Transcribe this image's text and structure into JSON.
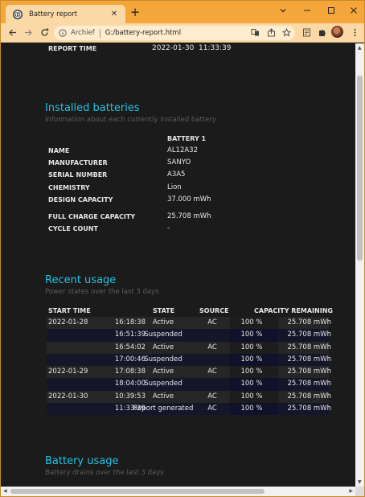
{
  "browser": {
    "tab_title": "Battery report",
    "tab_close": "✕",
    "new_tab": "+",
    "address_scheme": "Archief",
    "address_url": "G:/battery-report.html",
    "window_controls": [
      "chevron-down",
      "minimize",
      "maximize",
      "close"
    ],
    "colors": {
      "frame": "#f4a63b",
      "toolbar": "#fbd9a6",
      "accent_text": "#22c2e0"
    }
  },
  "report": {
    "report_time_label": "REPORT TIME",
    "report_time_value": "2022-01-30  11:33:39",
    "installed": {
      "title": "Installed batteries",
      "subtitle": "Information about each currently installed battery",
      "column_header": "BATTERY 1",
      "rows": [
        {
          "label": "NAME",
          "value": "AL12A32"
        },
        {
          "label": "MANUFACTURER",
          "value": "SANYO"
        },
        {
          "label": "SERIAL NUMBER",
          "value": "A3A5"
        },
        {
          "label": "CHEMISTRY",
          "value": "Lion"
        },
        {
          "label": "DESIGN CAPACITY",
          "value": "37.000 mWh"
        },
        {
          "label": "FULL CHARGE CAPACITY",
          "value": "25.708 mWh"
        },
        {
          "label": "CYCLE COUNT",
          "value": "-"
        }
      ]
    },
    "recent_usage": {
      "title": "Recent usage",
      "subtitle": "Power states over the last 3 days",
      "headers": {
        "start_time": "START TIME",
        "state": "STATE",
        "source": "SOURCE",
        "capacity_remaining": "CAPACITY REMAINING"
      },
      "rows": [
        {
          "date": "2022-01-28",
          "time": "16:18:38",
          "state": "Active",
          "source": "AC",
          "percent": "100 %",
          "mwh": "25.708 mWh"
        },
        {
          "date": "",
          "time": "16:51:39",
          "state": "Suspended",
          "source": "",
          "percent": "100 %",
          "mwh": "25.708 mWh"
        },
        {
          "date": "",
          "time": "16:54:02",
          "state": "Active",
          "source": "AC",
          "percent": "100 %",
          "mwh": "25.708 mWh"
        },
        {
          "date": "",
          "time": "17:00:46",
          "state": "Suspended",
          "source": "",
          "percent": "100 %",
          "mwh": "25.708 mWh"
        },
        {
          "date": "2022-01-29",
          "time": "17:08:38",
          "state": "Active",
          "source": "AC",
          "percent": "100 %",
          "mwh": "25.708 mWh"
        },
        {
          "date": "",
          "time": "18:04:00",
          "state": "Suspended",
          "source": "",
          "percent": "100 %",
          "mwh": "25.708 mWh"
        },
        {
          "date": "2022-01-30",
          "time": "10:39:53",
          "state": "Active",
          "source": "AC",
          "percent": "100 %",
          "mwh": "25.708 mWh"
        },
        {
          "date": "",
          "time": "11:33:39",
          "state": "Report generated",
          "source": "AC",
          "percent": "100 %",
          "mwh": "25.708 mWh"
        }
      ]
    },
    "battery_usage": {
      "title": "Battery usage",
      "subtitle": "Battery drains over the last 3 days"
    }
  }
}
